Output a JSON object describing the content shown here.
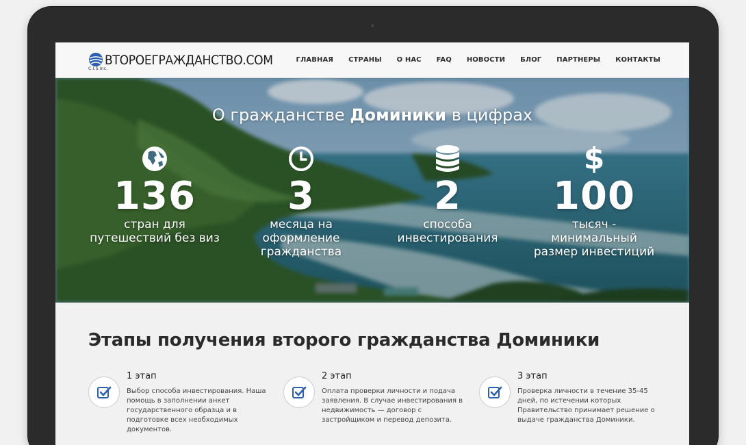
{
  "header": {
    "logo_text": "ВТОРОЕГРАЖДАНСТВО.COM",
    "logo_sub": "C.I.S.Inc.",
    "nav": [
      "ГЛАВНАЯ",
      "СТРАНЫ",
      "О НАС",
      "FAQ",
      "НОВОСТИ",
      "БЛОГ",
      "ПАРТНЕРЫ",
      "КОНТАКТЫ"
    ]
  },
  "hero": {
    "title_prefix": "О гражданстве ",
    "title_bold": "Доминики",
    "title_suffix": " в цифрах",
    "stats": [
      {
        "icon": "globe-icon",
        "number": "136",
        "label": "стран для путешествий без виз"
      },
      {
        "icon": "clock-icon",
        "number": "3",
        "label": "месяца на оформление гражданства"
      },
      {
        "icon": "database-icon",
        "number": "2",
        "label": "способа инвестирования"
      },
      {
        "icon": "dollar-icon",
        "number": "100",
        "label": "тысяч - минимальный размер инвестиций"
      }
    ]
  },
  "steps": {
    "title_prefix": "Этапы получения второго ",
    "title_bold": "гражданства Доминики",
    "items": [
      {
        "name": "1 этап",
        "text": "Выбор способа инвестирования. Наша помощь в заполнении анкет государственного образца и в подготовке всех необходимых документов."
      },
      {
        "name": "2 этап",
        "text": "Оплата проверки личности и подача заявления. В случае инвестирования в недвижимость — договор с застройщиком и перевод депозита."
      },
      {
        "name": "3 этап",
        "text": "Проверка личности в течение 35-45 дней, по истечении которых Правительство принимает решение о выдаче гражданства Доминики."
      }
    ]
  },
  "colors": {
    "accent": "#2b5fae",
    "frame": "#2b2b2b"
  }
}
